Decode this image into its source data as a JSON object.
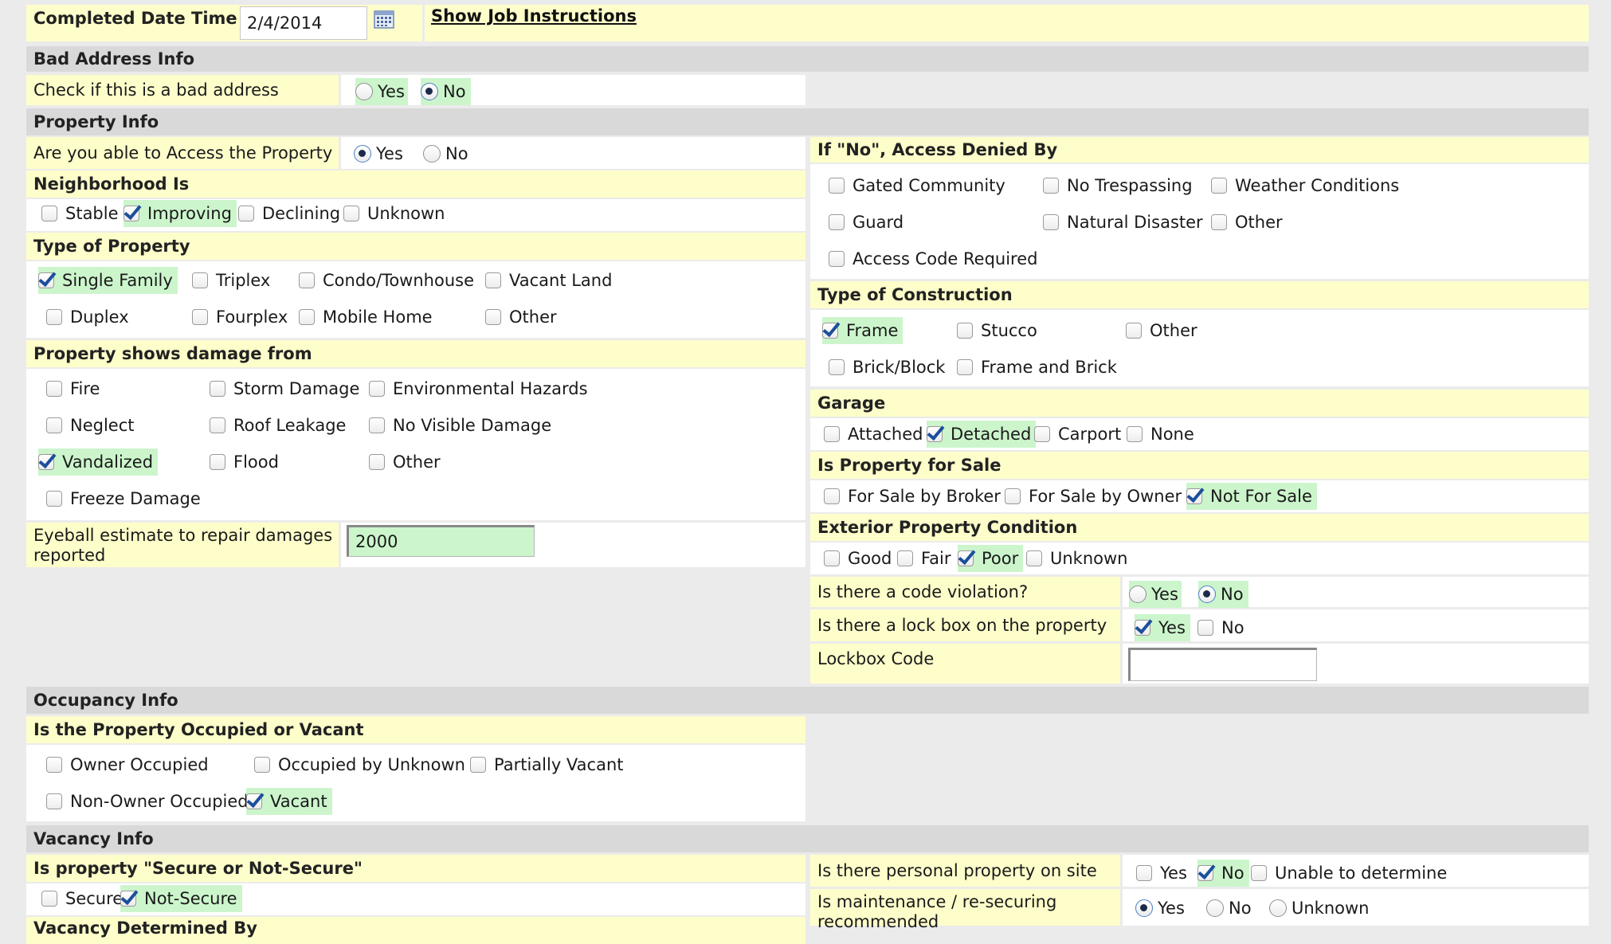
{
  "completed": {
    "label": "Completed Date Time",
    "value": "2/4/2014",
    "show_job_instructions": "Show Job Instructions"
  },
  "bad_address": {
    "header": "Bad Address Info",
    "question": "Check if this is a bad address",
    "yes": "Yes",
    "no": "No",
    "selected": "No"
  },
  "property_info": {
    "header": "Property Info",
    "access_question": "Are you able to Access the Property",
    "access_yes": "Yes",
    "access_no": "No",
    "access_selected": "Yes",
    "neighborhood": {
      "header": "Neighborhood Is",
      "options": [
        {
          "label": "Stable",
          "checked": false
        },
        {
          "label": "Improving",
          "checked": true
        },
        {
          "label": "Declining",
          "checked": false
        },
        {
          "label": "Unknown",
          "checked": false
        }
      ]
    },
    "type_of_property": {
      "header": "Type of Property",
      "options": [
        {
          "label": "Single Family",
          "checked": true
        },
        {
          "label": "Triplex",
          "checked": false
        },
        {
          "label": "Condo/Townhouse",
          "checked": false
        },
        {
          "label": "Vacant Land",
          "checked": false
        },
        {
          "label": "Duplex",
          "checked": false
        },
        {
          "label": "Fourplex",
          "checked": false
        },
        {
          "label": "Mobile Home",
          "checked": false
        },
        {
          "label": "Other",
          "checked": false
        }
      ]
    },
    "damage": {
      "header": "Property shows damage from",
      "options": [
        {
          "label": "Fire",
          "checked": false
        },
        {
          "label": "Storm Damage",
          "checked": false
        },
        {
          "label": "Environmental Hazards",
          "checked": false
        },
        {
          "label": "Neglect",
          "checked": false
        },
        {
          "label": "Roof Leakage",
          "checked": false
        },
        {
          "label": "No Visible Damage",
          "checked": false
        },
        {
          "label": "Vandalized",
          "checked": true
        },
        {
          "label": "Flood",
          "checked": false
        },
        {
          "label": "Other",
          "checked": false
        },
        {
          "label": "Freeze Damage",
          "checked": false
        }
      ]
    },
    "estimate": {
      "label_line1": "Eyeball estimate to repair damages",
      "label_line2": "reported",
      "value": "2000"
    }
  },
  "access_denied": {
    "header": "If \"No\", Access Denied By",
    "options": [
      {
        "label": "Gated Community",
        "checked": false
      },
      {
        "label": "No Trespassing",
        "checked": false
      },
      {
        "label": "Weather Conditions",
        "checked": false
      },
      {
        "label": "Guard",
        "checked": false
      },
      {
        "label": "Natural Disaster",
        "checked": false
      },
      {
        "label": "Other",
        "checked": false
      },
      {
        "label": "Access Code Required",
        "checked": false
      }
    ]
  },
  "construction": {
    "header": "Type of Construction",
    "options": [
      {
        "label": "Frame",
        "checked": true
      },
      {
        "label": "Stucco",
        "checked": false
      },
      {
        "label": "Other",
        "checked": false
      },
      {
        "label": "Brick/Block",
        "checked": false
      },
      {
        "label": "Frame and Brick",
        "checked": false
      }
    ]
  },
  "garage": {
    "header": "Garage",
    "options": [
      {
        "label": "Attached",
        "checked": false
      },
      {
        "label": "Detached",
        "checked": true
      },
      {
        "label": "Carport",
        "checked": false
      },
      {
        "label": "None",
        "checked": false
      }
    ]
  },
  "for_sale": {
    "header": "Is Property for Sale",
    "options": [
      {
        "label": "For Sale by Broker",
        "checked": false
      },
      {
        "label": "For Sale by Owner",
        "checked": false
      },
      {
        "label": "Not For Sale",
        "checked": true
      }
    ]
  },
  "exterior": {
    "header": "Exterior Property Condition",
    "options": [
      {
        "label": "Good",
        "checked": false
      },
      {
        "label": "Fair",
        "checked": false
      },
      {
        "label": "Poor",
        "checked": true
      },
      {
        "label": "Unknown",
        "checked": false
      }
    ]
  },
  "code_violation": {
    "question": "Is there a code violation?",
    "yes": "Yes",
    "no": "No",
    "selected": "No"
  },
  "lock_box": {
    "question": "Is there a lock box on the property",
    "yes": "Yes",
    "no": "No",
    "selected": "Yes"
  },
  "lockbox_code": {
    "label": "Lockbox Code",
    "value": ""
  },
  "occupancy": {
    "header": "Occupancy Info",
    "subheader": "Is the Property Occupied or Vacant",
    "options": [
      {
        "label": "Owner Occupied",
        "checked": false
      },
      {
        "label": "Occupied by Unknown",
        "checked": false
      },
      {
        "label": "Partially Vacant",
        "checked": false
      },
      {
        "label": "Non-Owner Occupied",
        "checked": false
      },
      {
        "label": "Vacant",
        "checked": true
      }
    ]
  },
  "vacancy": {
    "header": "Vacancy Info",
    "secure_header": "Is property \"Secure or Not-Secure\"",
    "secure_options": [
      {
        "label": "Secure",
        "checked": false
      },
      {
        "label": "Not-Secure",
        "checked": true
      }
    ],
    "next_header": "Vacancy Determined By",
    "personal_property": {
      "question": "Is there personal property on site",
      "options": [
        {
          "label": "Yes",
          "checked": false
        },
        {
          "label": "No",
          "checked": true
        },
        {
          "label": "Unable to determine",
          "checked": false
        }
      ]
    },
    "maintenance": {
      "question_line1": "Is maintenance / re-securing",
      "question_line2": "recommended",
      "yes": "Yes",
      "no": "No",
      "unknown": "Unknown",
      "selected": "Yes"
    }
  },
  "colors": {
    "background": "#ebebeb",
    "section_header": "#d9d9d9",
    "label_bg": "#fefecb",
    "selected_bg": "#ccf5cc",
    "check": "#1b4f9c"
  }
}
